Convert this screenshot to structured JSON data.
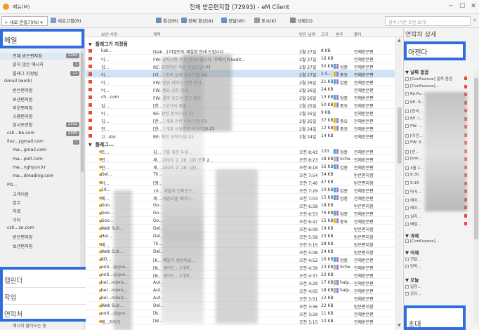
{
  "titlebar": {
    "menu": "메뉴(M)",
    "title": "전체 받은편지함 (72993) - eM Client",
    "buttons": [
      "─",
      "☐",
      "✕"
    ]
  },
  "toolbar": {
    "new_mail": "+ 새로 만들기(N)",
    "new_menu_arrow": "▾",
    "new_group": "새로고침(R)",
    "reply": "회신(R)",
    "reply_all": "전체 회신(A)",
    "forward": "전달(W)",
    "mark": "표시(K)",
    "delete": "삭제(D)",
    "search_placeholder": "검색 (기존 트윈 보기)",
    "search_clear": "✕"
  },
  "left": {
    "header": "메일",
    "folders": [
      {
        "label": "전체 받은편지함",
        "badge": "2264",
        "indent": 18,
        "selected": true
      },
      {
        "label": "읽지 않은 메시지",
        "badge": "1",
        "indent": 18
      },
      {
        "label": "플래그 지정됨",
        "badge": "11",
        "indent": 18
      },
      {
        "label": "Gmail (work)",
        "badge": "",
        "indent": 6
      },
      {
        "label": "받은편지함",
        "badge": "",
        "indent": 18
      },
      {
        "label": "보낸편지함",
        "badge": "",
        "indent": 18
      },
      {
        "label": "지운편지함",
        "badge": "",
        "indent": 18
      },
      {
        "label": "스팸편지함",
        "badge": "",
        "indent": 18
      },
      {
        "label": "임시보관함",
        "badge": "2192",
        "indent": 18
      },
      {
        "label": "csh...be.com",
        "badge": "2185",
        "indent": 10
      },
      {
        "label": "ilov...ygmail.com",
        "badge": "1",
        "indent": 10
      },
      {
        "label": "ma...gmail.com",
        "badge": "",
        "indent": 18
      },
      {
        "label": "ma...potl.com",
        "badge": "",
        "indent": 18
      },
      {
        "label": "ma...nghyun.kr",
        "badge": "",
        "indent": 18
      },
      {
        "label": "ma...dreading.com",
        "badge": "",
        "indent": 18
      },
      {
        "label": "PO...",
        "badge": "",
        "indent": 10
      },
      {
        "label": "고객지원",
        "badge": "",
        "indent": 18
      },
      {
        "label": "업무",
        "badge": "",
        "indent": 18
      },
      {
        "label": "자료",
        "badge": "",
        "indent": 18
      },
      {
        "label": "기타",
        "badge": "",
        "indent": 18
      },
      {
        "label": "csh...se.com",
        "badge": "",
        "indent": 10
      },
      {
        "label": "받은편지함",
        "badge": "",
        "indent": 18
      },
      {
        "label": "보낸편지함",
        "badge": "",
        "indent": 18
      }
    ],
    "nav": [
      "캘린더",
      "작업",
      "연락처"
    ],
    "footer": "메시지 불러오는 중"
  },
  "columns": [
    "보낸 사람",
    "제목",
    "받은 날짜",
    "크기",
    "범주",
    "폴더"
  ],
  "groups": {
    "flagged": "플래그가 지정됨",
    "other": "플래그..."
  },
  "flagged_rows": [
    {
      "from": "kak...",
      "subject": "[kak...] 비밀번호 재설정 안내 드립니다",
      "date": "2월 27일",
      "size": "8 KB",
      "cat": "",
      "folder": "전체받은편"
    },
    {
      "from": "이...",
      "subject": "FW: 공지사항 추가 안내드립니다. 부에서 fckedit...",
      "date": "2월 27일",
      "size": "16 KB",
      "cat": "",
      "folder": "전체받은편"
    },
    {
      "from": "김...",
      "subject": "RE: 요청하신 자료 전달드립니다",
      "date": "2월 27일",
      "size": "50 KB",
      "cat": "업종",
      "folder": "전체받은편"
    },
    {
      "from": "이...",
      "subject": "[이...] 회의 일정 공유드립니다",
      "date": "2월 27일",
      "size": "2.5...",
      "cat": "중요",
      "folder": "전체받은편",
      "selected": true
    },
    {
      "from": "이...",
      "subject": "FW: 신규 서비스 관련 안내",
      "date": "2월 26일",
      "size": "21 KB",
      "cat": "업종",
      "folder": "전체받은편"
    },
    {
      "from": "이...",
      "subject": "FW: 중요 공지 안내",
      "date": "2월 26일",
      "size": "24 KB",
      "cat": "",
      "folder": "전체받은편"
    },
    {
      "from": "ch...com",
      "subject": "FW: 결과 보고서 광고 발송",
      "date": "2월 26일",
      "size": "13 KB",
      "cat": "업종",
      "folder": "전체받은편"
    },
    {
      "from": "김...",
      "subject": "[한...] 보고서 제출",
      "date": "2월 25일",
      "size": "50 KB",
      "cat": "중요",
      "folder": "전체받은편"
    },
    {
      "from": "이...",
      "subject": "RE: 관련 문의드립니다",
      "date": "2월 25일",
      "size": "9 KB",
      "cat": "",
      "folder": "전체받은편"
    },
    {
      "from": "김...",
      "subject": "[한...] 계획 관련 이야기입니다",
      "date": "2월 25일",
      "size": "37 KB",
      "cat": "중요",
      "folder": "전체받은편"
    },
    {
      "from": "전...",
      "subject": "[한...] 계획 사용관련 이야기입니다",
      "date": "2월 24일",
      "size": "12 KB",
      "cat": "중요",
      "folder": "전체받은편"
    },
    {
      "from": "고...Ko)",
      "subject": "RE: 확인 부탁드립니다",
      "date": "2월 24일",
      "size": "14 KB",
      "cat": "",
      "folder": "전체받은편"
    },
    {
      "from": "관...luence)",
      "subject": "[Co...] 문서 업데이트",
      "date": "2월 24일",
      "size": "10 KB",
      "cat": "",
      "folder": "전체받은편"
    }
  ],
  "other_rows": [
    {
      "from": "조...",
      "subject": "김... 구를 위한 두루...",
      "date": "오전 8:43",
      "size": "120...",
      "cat": "업종",
      "folder": "전체받은편"
    },
    {
      "from": "전...",
      "subject": "세... 2020. 2. 28. (금) 오후 2...",
      "date": "오전 8:23",
      "size": "18 KB",
      "cat": "Sche...",
      "folder": "전체받은편"
    },
    {
      "from": "전...",
      "subject": "세... 2020. 2. 28. (금)...",
      "date": "오전 8:18",
      "size": "16 KB",
      "cat": "업종",
      "folder": "전체받은편"
    },
    {
      "from": "Del...",
      "subject": "Th...",
      "date": "오전 7:54",
      "size": "34 KB",
      "cat": "",
      "folder": "받은편지함"
    },
    {
      "from": "아...",
      "subject": "[광...",
      "date": "오전 7:40",
      "size": "47 KB",
      "cat": "",
      "folder": "받은편지함"
    },
    {
      "from": "10...",
      "subject": "10... 개발자 컨퍼런스...",
      "date": "오전 7:29",
      "size": "10 KB",
      "cat": "업종",
      "folder": "전체받은편"
    },
    {
      "from": "제...",
      "subject": "제... 사업모델 세미나...",
      "date": "오전 7:03",
      "size": "15 KB",
      "cat": "업종",
      "folder": "전체받은편"
    },
    {
      "from": "Goo...",
      "subject": "Go...",
      "date": "오전 6:58",
      "size": "18 KB",
      "cat": "",
      "folder": "받은편지함"
    },
    {
      "from": "Goo...",
      "subject": "Go...",
      "date": "오전 6:53",
      "size": "76 KB",
      "cat": "업종",
      "folder": "전체받은편"
    },
    {
      "from": "Goo...",
      "subject": "Go...",
      "date": "오전 6:47",
      "size": "15 KB",
      "cat": "중요",
      "folder": "전체받은편"
    },
    {
      "from": "Web Sub...",
      "subject": "Del...",
      "date": "오전 6:09",
      "size": "19 KB",
      "cat": "",
      "folder": "받은편지함"
    },
    {
      "from": "Hel...",
      "subject": "Del...",
      "date": "오전 5:58",
      "size": "23 KB",
      "cat": "",
      "folder": "받은편지함"
    },
    {
      "from": "때...",
      "subject": "Th...",
      "date": "오전 5:15",
      "size": "28 KB",
      "cat": "",
      "folder": "받은편지함"
    },
    {
      "from": "Web Sub...",
      "subject": "Del...",
      "date": "오전 5:08",
      "size": "24 KB",
      "cat": "",
      "folder": "받은편지함"
    },
    {
      "from": "KD...",
      "subject": "[K... 메일이 생성되었...",
      "date": "오전 4:52",
      "size": "16 KB",
      "cat": "업종",
      "folder": "전체받은편"
    },
    {
      "from": "noti...@goo...",
      "subject": "[N... 웨이드 - 3개의...",
      "date": "오전 4:39",
      "size": "23 KB",
      "cat": "Sche...",
      "folder": "전체받은편"
    },
    {
      "from": "noti...@goo...",
      "subject": "[N... 웨이드 - 3개의...",
      "date": "오전 4:37",
      "size": "22 KB",
      "cat": "",
      "folder": "전체받은편"
    },
    {
      "from": "hel...ndwis...",
      "subject": "Aut...",
      "date": "오전 4:29",
      "size": "17 KB",
      "cat": "halp...",
      "folder": "전체받은편"
    },
    {
      "from": "hel...ndwis...",
      "subject": "Aut...",
      "date": "오전 4:05",
      "size": "18 KB",
      "cat": "halp...",
      "folder": "전체받은편"
    },
    {
      "from": "hel...ndwis...",
      "subject": "Aut...",
      "date": "오전 3:51",
      "size": "12 KB",
      "cat": "",
      "folder": "전체받은편"
    },
    {
      "from": "Web Sub...",
      "subject": "Del...",
      "date": "오전 3:36",
      "size": "22 KB",
      "cat": "",
      "folder": "받은편지함"
    },
    {
      "from": "noti...@goo...",
      "subject": "[N...",
      "date": "오전 3:29",
      "size": "11 KB",
      "cat": "",
      "folder": "전체받은편"
    },
    {
      "from": "앵...이야기",
      "subject": "[W...",
      "date": "오전 3:15",
      "size": "10 KB",
      "cat": "",
      "folder": "전체받은편"
    }
  ],
  "right": {
    "header": "연락처 상세",
    "agenda": "아젠다",
    "group_none": "날짜 없음",
    "items_none": [
      "[Confluence] 일치 점검",
      "[Confluence]...",
      "Re:Pu...",
      "RE: R...",
      "[한국...",
      "RE: (...",
      "FW: ...",
      "[이전...",
      "FW: 9...",
      "[안...",
      "[kok...",
      "3월 1...",
      "8:30",
      "9:15",
      "마라...",
      "에이...",
      "레이...",
      "실리...",
      "배열..."
    ],
    "group_more": "과제",
    "more_item": "[Confluence]...",
    "group_upcoming": "어제",
    "upcoming_items": [
      "전달...",
      "연락..."
    ],
    "group_today": "오늘",
    "today_items": [
      "일정...",
      "공유..."
    ],
    "invite": "초대"
  },
  "colors": {
    "accent_border": "#2f6de0",
    "flag": "#e84c3d",
    "unread_dot": "#f0a020",
    "selection": "#cfe3f7"
  }
}
